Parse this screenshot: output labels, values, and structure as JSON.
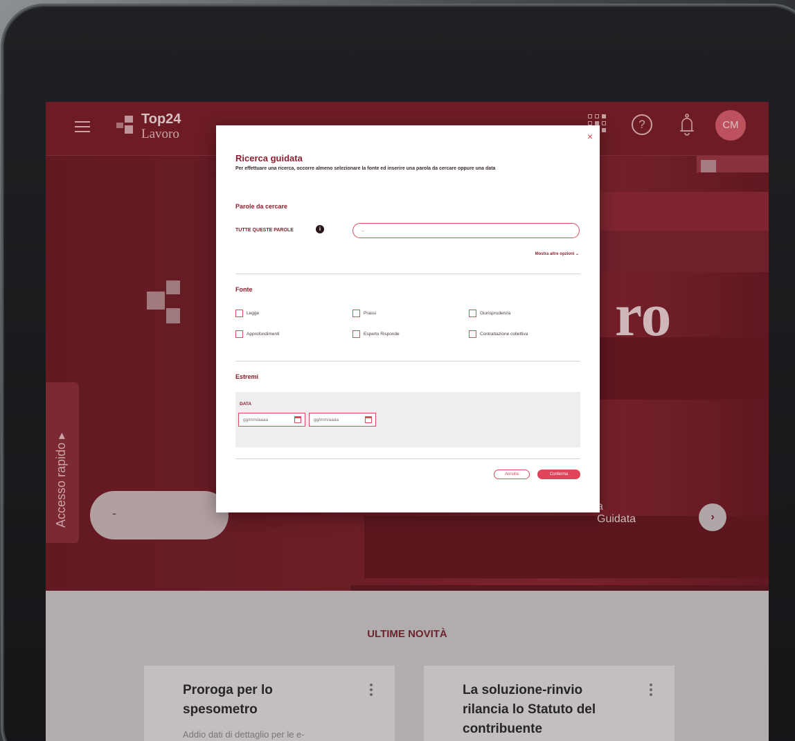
{
  "app": {
    "brand_top": "Top24",
    "brand_bottom": "Lavoro",
    "avatar_initials": "CM",
    "help_glyph": "?"
  },
  "hero": {
    "title_fragment": "ro",
    "quick_access_label": "Accesso rapido ▸",
    "search_value": "-",
    "guided_label": "a\nGuidata",
    "go_glyph": "›"
  },
  "modal": {
    "close_glyph": "×",
    "title": "Ricerca guidata",
    "subtitle": "Per effettuare una ricerca, occorre almeno selezionare la fonte ed inserire una parola da cercare oppure una data",
    "words_section": "Parole da cercare",
    "all_words_label": "TUTTE QUESTE PAROLE",
    "info_glyph": "i",
    "words_input_value": "–",
    "more_options": "Mostra altre opzioni ⌄",
    "source_section": "Fonte",
    "sources": [
      "Legge",
      "Prassi",
      "Giurisprudenza",
      "Approfondimenti",
      "Esperto Risponde",
      "Contrattazione collettiva"
    ],
    "extremes_section": "Estremi",
    "date_label": "DATA",
    "date_from_placeholder": "gg/mm/aaaa",
    "date_to_placeholder": "gg/mm/aaaa",
    "cancel_label": "Annulla",
    "confirm_label": "Conferma"
  },
  "news": {
    "section_title": "ULTIME NOVITÀ",
    "cards": [
      {
        "title": "Proroga per lo spesometro",
        "desc": "Addio dati di dettaglio per le e-"
      },
      {
        "title": "La soluzione-rinvio rilancia lo Statuto del contribuente",
        "desc": ""
      }
    ]
  }
}
